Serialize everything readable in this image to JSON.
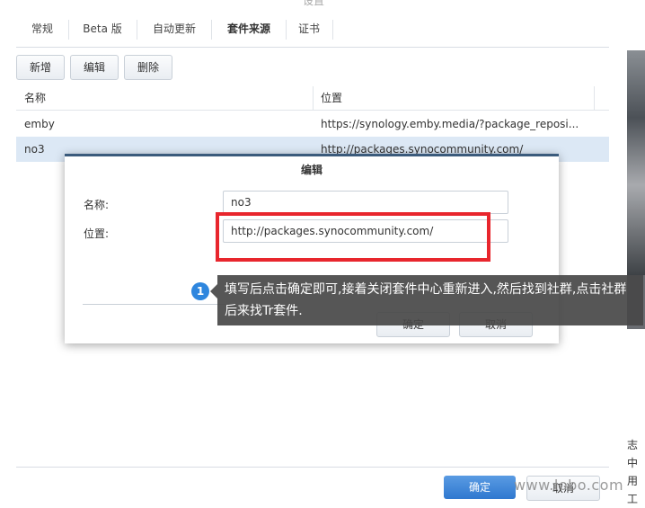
{
  "window": {
    "title": "设置"
  },
  "tabs": [
    {
      "label": "常规"
    },
    {
      "label": "Beta 版"
    },
    {
      "label": "自动更新"
    },
    {
      "label": "套件来源"
    },
    {
      "label": "证书"
    }
  ],
  "toolbar": {
    "add_label": "新增",
    "edit_label": "编辑",
    "delete_label": "删除"
  },
  "grid": {
    "columns": [
      "名称",
      "位置"
    ],
    "rows": [
      {
        "name": "emby",
        "location": "https://synology.emby.media/?package_reposi..."
      },
      {
        "name": "no3",
        "location": "http://packages.synocommunity.com/"
      }
    ]
  },
  "dialog": {
    "title": "编辑",
    "name_label": "名称:",
    "name_value": "no3",
    "location_label": "位置:",
    "location_value": "http://packages.synocommunity.com/",
    "ok_label": "确定",
    "cancel_label": "取消"
  },
  "annotation": {
    "badge": "1",
    "text": "填写后点击确定即可,接着关闭套件中心重新进入,然后找到社群,点击社群后来找Tr套件."
  },
  "footer": {
    "ok_label": "确定",
    "cancel_label": "取消"
  },
  "background_right": {
    "line1": "志中",
    "line2": "用工"
  },
  "watermark": "www.lobo.com",
  "colors": {
    "accent": "#2f78cf",
    "highlight_box": "#e8262d",
    "selected_row": "#dce8f5",
    "dialog_border": "#3b5b7c"
  }
}
